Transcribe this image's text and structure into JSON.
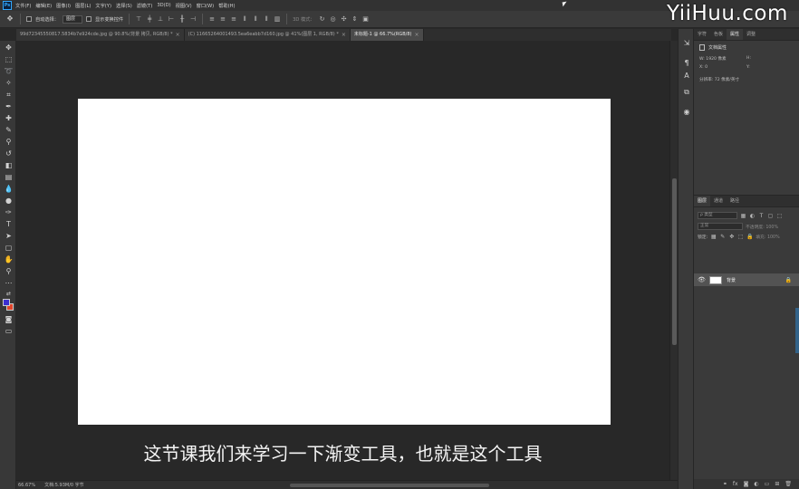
{
  "app": {
    "logo": "Ps"
  },
  "menubar": {
    "items": [
      "文件(F)",
      "编辑(E)",
      "图像(I)",
      "图层(L)",
      "文字(Y)",
      "选择(S)",
      "滤镜(T)",
      "3D(D)",
      "视图(V)",
      "窗口(W)",
      "帮助(H)"
    ]
  },
  "options": {
    "auto_select_label": "自动选择：",
    "auto_select_value": "图层",
    "transform_label": "显示变换控件",
    "mode3d_label": "3D 模式："
  },
  "tabs": [
    {
      "label": "99d72345550817.5834b7e924cde.jpg @ 90.8%(背景 拷贝, RGB/8) *"
    },
    {
      "label": "(C) 11665264001493.5ea6eabb7d160.jpg @ 41%(图层 1, RGB/8) *"
    },
    {
      "label": "未标题-1 @ 66.7%(RGB/8)",
      "active": true
    }
  ],
  "subtitle": "这节课我们来学习一下渐变工具，也就是这个工具",
  "status": {
    "zoom": "66.67%",
    "doc": "文档:5.93M/0 字节"
  },
  "panels": {
    "top_tabs": [
      "字符",
      "色板",
      "属性",
      "调整"
    ],
    "active_top_tab": "属性",
    "doc_props_label": "文档属性",
    "w_label": "W: 1920 像素",
    "h_label": "H:",
    "x_label": "X: 0",
    "y_label": "Y:",
    "resolution": "分辨率: 72 像素/英寸",
    "layer_tabs": [
      "图层",
      "通道",
      "路径"
    ],
    "kind_label": "ρ 类型",
    "blend_mode": "正常",
    "opacity_label": "不透明度: 100%",
    "lock_label": "锁定:",
    "fill_label": "填充: 100%",
    "layer_name": "背景"
  },
  "watermark": "YiiHuu.com"
}
